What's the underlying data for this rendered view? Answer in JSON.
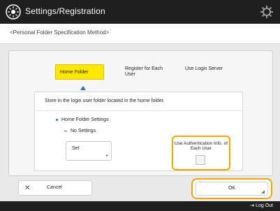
{
  "titlebar": {
    "title": "Settings/Registration"
  },
  "subheader": {
    "breadcrumb": "<Personal Folder Specification Method>"
  },
  "options": [
    {
      "label": "Home Folder",
      "selected": true
    },
    {
      "label": "Register for Each User",
      "selected": false
    },
    {
      "label": "Use Login Server",
      "selected": false
    }
  ],
  "inner": {
    "description": "Store in the login user folder located in the home folder.",
    "home_folder_settings": "Home Folder Settings",
    "no_settings": "No Settings",
    "set_button": "Set",
    "use_auth_label": "Use Authentication Info. of Each User",
    "use_auth_checked": false
  },
  "bottom": {
    "cancel_label": "Cancel",
    "ok_label": "OK"
  },
  "footer": {
    "logout_label": "Log Out"
  },
  "colors": {
    "accent": "#ffe800",
    "highlight": "#f0a500",
    "bar": "#1f1f1f"
  }
}
